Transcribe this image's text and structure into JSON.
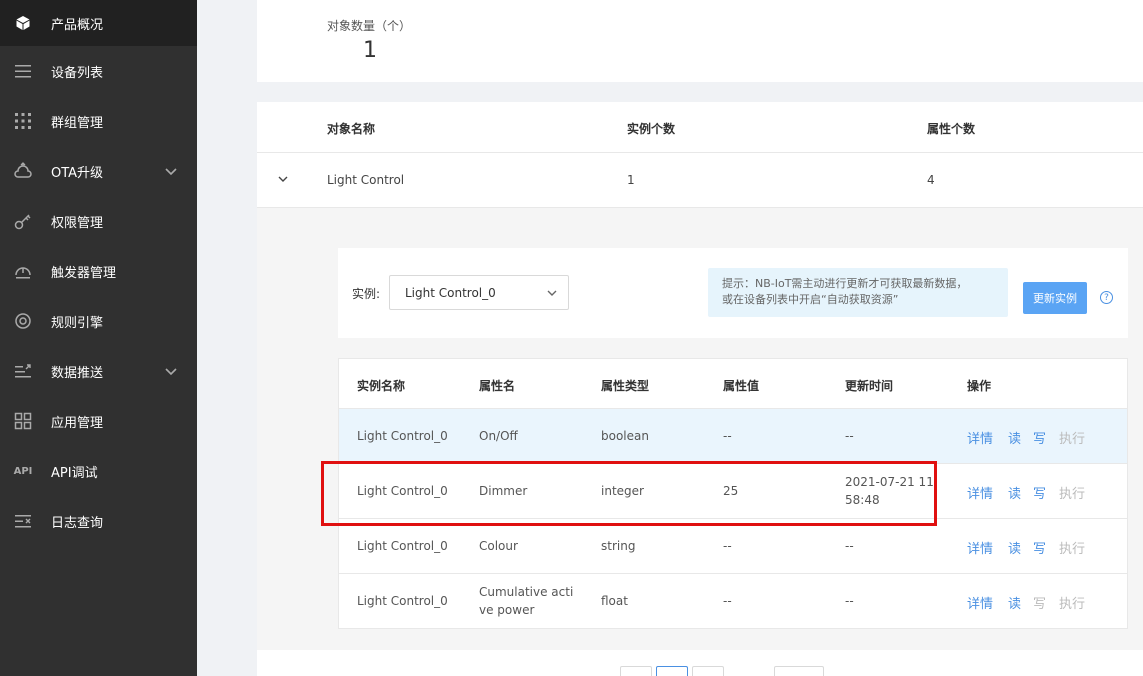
{
  "sidebar": {
    "items": [
      {
        "label": "产品概况",
        "icon": "cube-icon",
        "active": true
      },
      {
        "label": "设备列表",
        "icon": "list-icon"
      },
      {
        "label": "群组管理",
        "icon": "grid-dots-icon"
      },
      {
        "label": "OTA升级",
        "icon": "cloud-upload-icon",
        "expandable": true
      },
      {
        "label": "权限管理",
        "icon": "key-icon"
      },
      {
        "label": "触发器管理",
        "icon": "trigger-icon"
      },
      {
        "label": "规则引擎",
        "icon": "rule-icon"
      },
      {
        "label": "数据推送",
        "icon": "push-icon",
        "expandable": true
      },
      {
        "label": "应用管理",
        "icon": "apps-icon"
      },
      {
        "label": "API调试",
        "icon": "api-icon"
      },
      {
        "label": "日志查询",
        "icon": "log-icon"
      }
    ]
  },
  "stats": {
    "label": "对象数量（个）",
    "value": "1"
  },
  "objects": {
    "headers": {
      "name": "对象名称",
      "instances": "实例个数",
      "attrs": "属性个数"
    },
    "row": {
      "name": "Light Control",
      "instances": "1",
      "attrs": "4"
    }
  },
  "instance": {
    "label": "实例:",
    "selected": "Light Control_0",
    "hint_line1": "提示：NB-IoT需主动进行更新才可获取最新数据，",
    "hint_line2": "或在设备列表中开启“自动获取资源”",
    "refresh_label": "更新实例",
    "help": "?"
  },
  "attr_table": {
    "headers": {
      "inst": "实例名称",
      "name": "属性名",
      "type": "属性类型",
      "value": "属性值",
      "time": "更新时间",
      "ops": "操作"
    },
    "ops": {
      "detail": "详情",
      "read": "读",
      "write": "写",
      "exec": "执行"
    },
    "rows": [
      {
        "inst": "Light Control_0",
        "name": "On/Off",
        "name2": "",
        "type": "boolean",
        "value": "--",
        "time": "--",
        "time2": ""
      },
      {
        "inst": "Light Control_0",
        "name": "Dimmer",
        "name2": "",
        "type": "integer",
        "value": "25",
        "time": "2021-07-21 11:",
        "time2": "58:48"
      },
      {
        "inst": "Light Control_0",
        "name": "Colour",
        "name2": "",
        "type": "string",
        "value": "--",
        "time": "--",
        "time2": ""
      },
      {
        "inst": "Light Control_0",
        "name": "Cumulative acti",
        "name2": "ve power",
        "type": "float",
        "value": "--",
        "time": "--",
        "time2": ""
      }
    ]
  },
  "colors": {
    "accent": "#4a90e2",
    "sidebar": "#303030",
    "highlight": "#e01010"
  }
}
